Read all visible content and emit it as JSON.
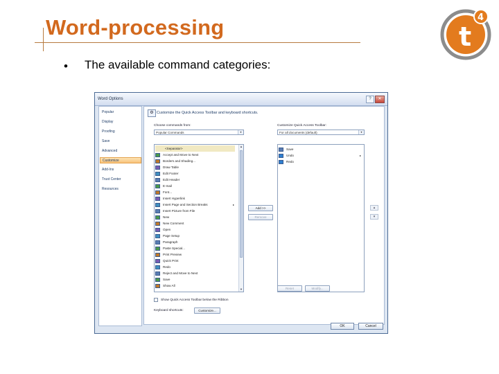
{
  "slide": {
    "title": "Word-processing",
    "bullet": "•",
    "bullet_text": "The available command categories:",
    "logo_text": "t",
    "logo_superscript": "4",
    "colors": {
      "title": "#d2691e",
      "logo_orange": "#e37b1e"
    }
  },
  "dialog": {
    "title": "Word Options",
    "help": "?",
    "close": "✕",
    "nav": [
      "Popular",
      "Display",
      "Proofing",
      "Save",
      "Advanced",
      "Customize",
      "Add-Ins",
      "Trust Center",
      "Resources"
    ],
    "nav_selected": "Customize",
    "header": "Customize the Quick Access Toolbar and keyboard shortcuts.",
    "choose_label": "Choose commands from:",
    "choose_value": "Popular Commands",
    "customize_label": "Customize Quick Access Toolbar:",
    "customize_value": "For all documents (default)",
    "commands": [
      {
        "label": "<Separator>",
        "separator": true
      },
      {
        "label": "Accept and Move to Next"
      },
      {
        "label": "Borders and Shading..."
      },
      {
        "label": "Draw Table"
      },
      {
        "label": "Edit Footer"
      },
      {
        "label": "Edit Header"
      },
      {
        "label": "E-mail"
      },
      {
        "label": "Font..."
      },
      {
        "label": "Insert Hyperlink"
      },
      {
        "label": "Insert Page and Section Breaks",
        "submenu": true
      },
      {
        "label": "Insert Picture from File"
      },
      {
        "label": "New"
      },
      {
        "label": "New Comment"
      },
      {
        "label": "Open"
      },
      {
        "label": "Page Setup"
      },
      {
        "label": "Paragraph"
      },
      {
        "label": "Paste Special..."
      },
      {
        "label": "Print Preview"
      },
      {
        "label": "Quick Print"
      },
      {
        "label": "Redo"
      },
      {
        "label": "Reject and Move to Next"
      },
      {
        "label": "Save"
      },
      {
        "label": "Show All"
      }
    ],
    "toolbar_items": [
      "Save",
      "Undo",
      "Redo"
    ],
    "add_button": "Add >>",
    "remove_button": "Remove",
    "reset_button": "Reset",
    "modify_button": "Modify...",
    "show_below_label": "Show Quick Access Toolbar below the Ribbon",
    "shortcuts_label": "Keyboard shortcuts:",
    "customize_button": "Customize...",
    "ok_button": "OK",
    "cancel_button": "Cancel",
    "up_arrow": "▲",
    "down_arrow": "▼",
    "combo_arrow": "▾",
    "submenu_arrow": "▸",
    "move_up": "▴",
    "move_down": "▾",
    "header_icon": "⚙"
  }
}
